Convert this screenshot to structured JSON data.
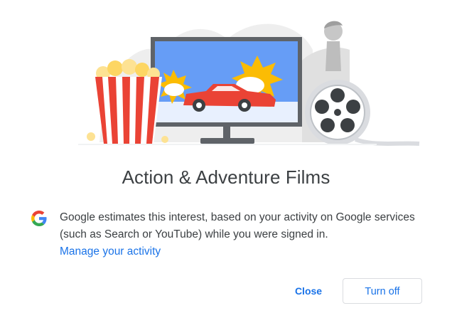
{
  "illustration": {
    "icon": "action-adventure-films-illustration"
  },
  "dialog": {
    "title": "Action & Adventure Films",
    "description": "Google estimates this interest, based on your activity on Google services (such as Search or YouTube) while you were signed in.",
    "link_label": "Manage your activity",
    "logo_icon": "google-g-logo"
  },
  "actions": {
    "close_label": "Close",
    "turn_off_label": "Turn off"
  },
  "colors": {
    "accent": "#1a73e8",
    "text": "#3c4043",
    "border": "#dadce0"
  }
}
